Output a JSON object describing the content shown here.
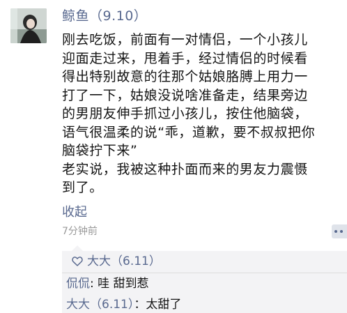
{
  "post": {
    "nickname": "鲸鱼（9.10）",
    "body_lines": [
      "刚去吃饭，前面有一对情侣，一个小孩儿",
      "迎面走过来，甩着手，经过情侣的时候看",
      "得出特别故意的往那个姑娘胳膊上用力一",
      "打了一下，姑娘没说啥准备走，结果旁边",
      "的男朋友伸手抓过小孩儿，按住他脑袋，",
      "语气很温柔的说“乖，道歉，要不叔叔把你",
      "脑袋拧下来”",
      "老实说，我被这种扑面而来的男友力震慑",
      "到了。"
    ],
    "collapse_label": "收起",
    "timestamp": "7分钟前",
    "more_icon": "more-dots-icon"
  },
  "likes": {
    "icon": "heart-outline-icon",
    "names": "大大（6.11）"
  },
  "comments": [
    {
      "author": "侃侃",
      "separator": ": ",
      "text": "哇 甜到惹"
    },
    {
      "author": "大大（6.11）",
      "separator": "：",
      "text": "太甜了"
    }
  ],
  "colors": {
    "link": "#59698f",
    "text": "#141414",
    "muted": "#999999",
    "comment_bg": "#f3f3f5"
  }
}
